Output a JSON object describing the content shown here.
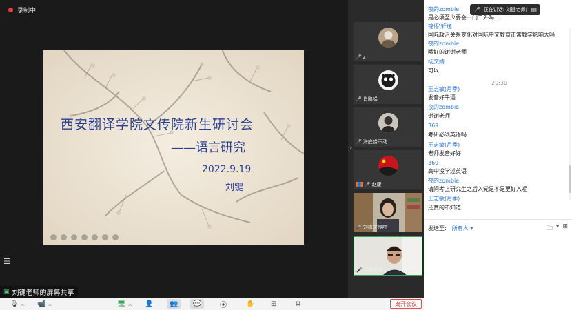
{
  "recording": {
    "label": "录制中"
  },
  "slide": {
    "title": "西安翻译学院文传院新生研讨会",
    "subtitle": "——语言研究",
    "date": "2022.9.19",
    "author": "刘键"
  },
  "share_label": "刘键老师的屏幕共享",
  "participants": [
    {
      "name": "z"
    },
    {
      "name": "肖鹏娟"
    },
    {
      "name": "海底捞不动"
    },
    {
      "name": "赵康"
    },
    {
      "name": "刘梅文传院"
    },
    {
      "name": "刘键老师"
    }
  ],
  "speaking": {
    "label": "正在讲话: 刘键老师;"
  },
  "chat": {
    "messages": [
      {
        "type": "name",
        "text": "夜的zombie"
      },
      {
        "type": "text",
        "text": "是必须至少要会一门二外吗..."
      },
      {
        "type": "name",
        "text": "锦语\\轩逸"
      },
      {
        "type": "text",
        "text": "国际政治关系变化对国际中文教育正常教学影响大吗"
      },
      {
        "type": "name",
        "text": "夜的zombie"
      },
      {
        "type": "text",
        "text": "哦好的谢谢老师"
      },
      {
        "type": "name",
        "text": "杨文婧"
      },
      {
        "type": "text",
        "text": "可以"
      },
      {
        "type": "time",
        "text": "20:30"
      },
      {
        "type": "name",
        "text": "王志敏(月季)"
      },
      {
        "type": "text",
        "text": "发音好牛逼"
      },
      {
        "type": "name",
        "text": "夜的zombie"
      },
      {
        "type": "text",
        "text": "谢谢老师"
      },
      {
        "type": "name",
        "text": "369"
      },
      {
        "type": "text",
        "text": "考研必须英语吗"
      },
      {
        "type": "name",
        "text": "王志敏(月季)"
      },
      {
        "type": "text",
        "text": "老师发音好好"
      },
      {
        "type": "name",
        "text": "369"
      },
      {
        "type": "text",
        "text": "高中没学过英语"
      },
      {
        "type": "name",
        "text": "夜的zombie"
      },
      {
        "type": "text",
        "text": "请问考上研究生之后入党是不是更好入呢"
      },
      {
        "type": "name",
        "text": "王志敏(月季)"
      },
      {
        "type": "text",
        "text": "还真的不知道"
      }
    ],
    "send_to_label": "发送至:",
    "send_to_value": "所有人 ▾"
  },
  "toolbar": {
    "leave_label": "离开会议"
  },
  "colors": {
    "accent": "#2b78e4",
    "record": "#e8413b",
    "slide_text": "#2b3f8e"
  }
}
